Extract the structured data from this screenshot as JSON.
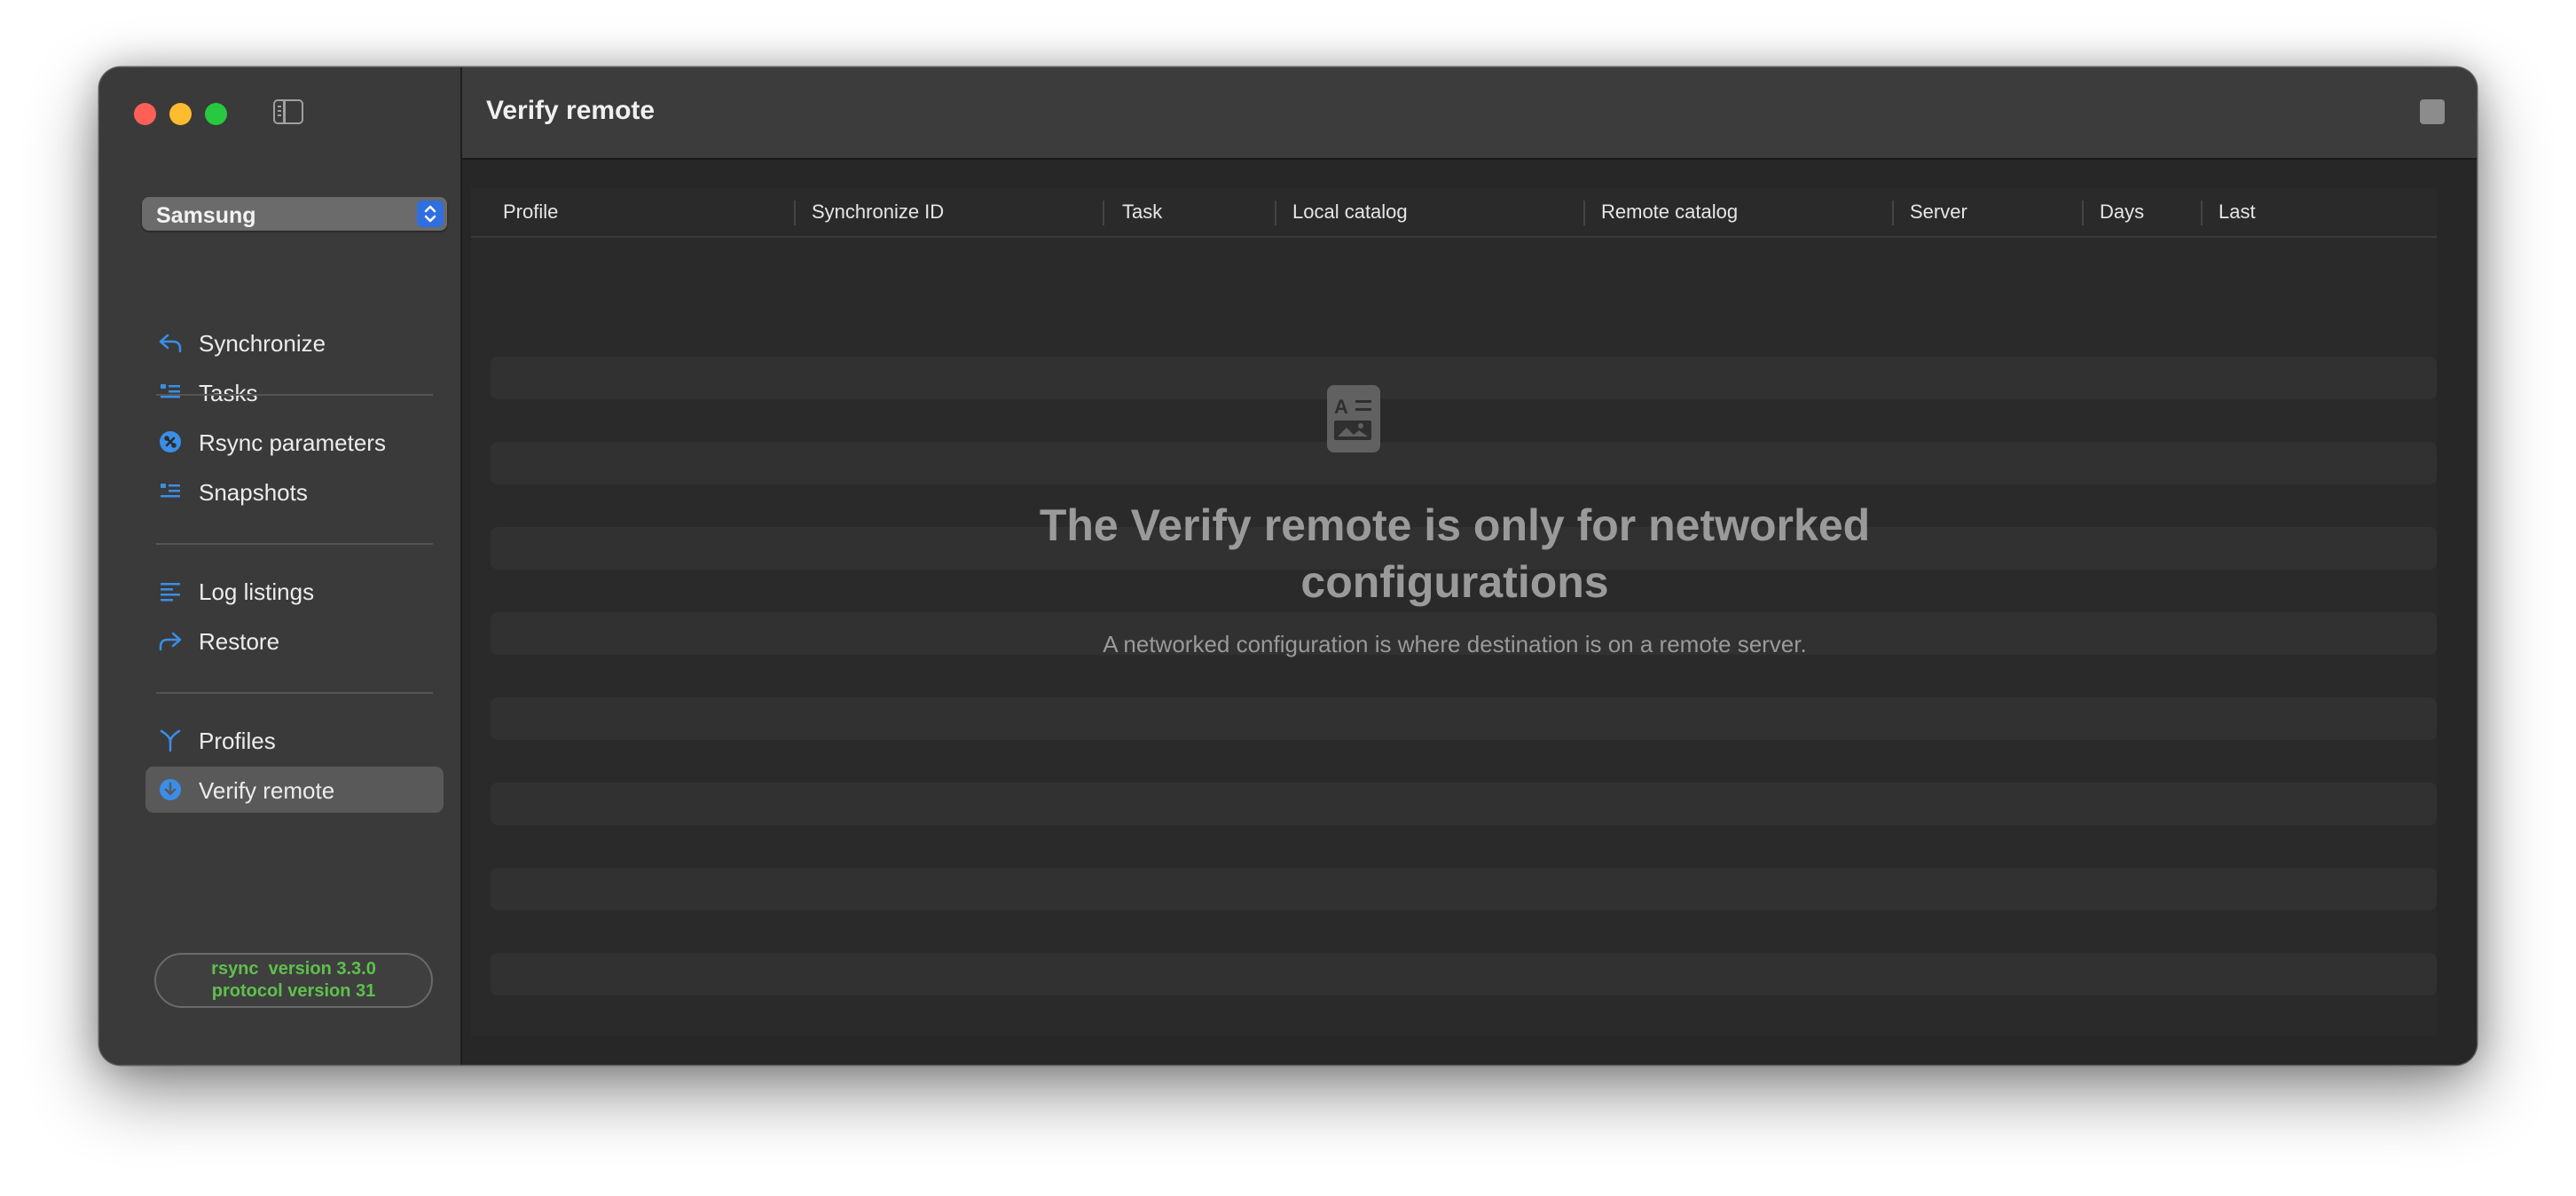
{
  "window": {
    "title": "Verify remote"
  },
  "sidebar": {
    "profile_selected": "Samsung",
    "items": [
      {
        "label": "Synchronize",
        "icon": "arrow-uturn-left-icon"
      },
      {
        "label": "Tasks",
        "icon": "list-icon"
      },
      {
        "label": "Rsync parameters",
        "icon": "command-circle-icon"
      },
      {
        "label": "Snapshots",
        "icon": "list-icon"
      },
      {
        "label": "Log listings",
        "icon": "text-align-left-icon"
      },
      {
        "label": "Restore",
        "icon": "arrow-uturn-right-icon"
      },
      {
        "label": "Profiles",
        "icon": "arrow-merge-icon"
      },
      {
        "label": "Verify remote",
        "icon": "arrow-down-circle-icon",
        "active": true
      }
    ],
    "version": {
      "line1": "rsync  version 3.3.0",
      "line2": "protocol version 31"
    }
  },
  "table": {
    "columns": [
      "Profile",
      "Synchronize ID",
      "Task",
      "Local catalog",
      "Remote catalog",
      "Server",
      "Days",
      "Last"
    ]
  },
  "empty_state": {
    "icon": "doc-richtext-icon",
    "title": "The Verify remote is only for networked configurations",
    "subtitle": "A networked configuration is where destination is on a remote server."
  },
  "colors": {
    "accent_blue": "#3a8ee6",
    "version_green": "#5fc04c",
    "select_blue": "#2f6fe0"
  }
}
